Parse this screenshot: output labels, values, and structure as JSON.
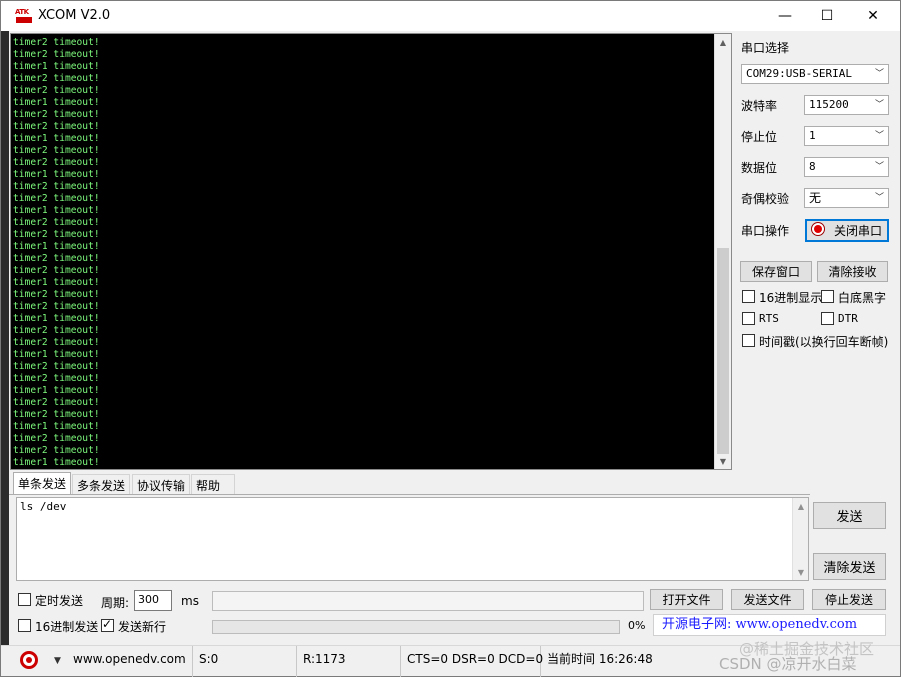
{
  "window": {
    "title": "XCOM V2.0",
    "icon_text": "ATK",
    "min_glyph": "—",
    "max_glyph": "☐",
    "close_glyph": "✕"
  },
  "receive": {
    "lines": [
      "timer2 timeout!",
      "timer2 timeout!",
      "timer1 timeout!",
      "timer2 timeout!",
      "timer2 timeout!",
      "timer1 timeout!",
      "timer2 timeout!",
      "timer2 timeout!",
      "timer1 timeout!",
      "timer2 timeout!",
      "timer2 timeout!",
      "timer1 timeout!",
      "timer2 timeout!",
      "timer2 timeout!",
      "timer1 timeout!",
      "timer2 timeout!",
      "timer2 timeout!",
      "timer1 timeout!",
      "timer2 timeout!",
      "timer2 timeout!",
      "timer1 timeout!",
      "timer2 timeout!",
      "timer2 timeout!",
      "timer1 timeout!",
      "timer2 timeout!",
      "timer2 timeout!",
      "timer1 timeout!",
      "timer2 timeout!",
      "timer2 timeout!",
      "timer1 timeout!",
      "timer2 timeout!",
      "timer2 timeout!",
      "timer1 timeout!",
      "timer2 timeout!",
      "timer2 timeout!",
      "timer1 timeout!",
      "timer2 timeout!"
    ]
  },
  "settings": {
    "port_label": "串口选择",
    "port_value": "COM29:USB-SERIAL",
    "baud_label": "波特率",
    "baud_value": "115200",
    "stop_label": "停止位",
    "stop_value": "1",
    "data_label": "数据位",
    "data_value": "8",
    "parity_label": "奇偶校验",
    "parity_value": "无",
    "op_label": "串口操作",
    "close_port_btn": "关闭串口",
    "save_window_btn": "保存窗口",
    "clear_recv_btn": "清除接收",
    "hex_display": "16进制显示",
    "white_bg": "白底黑字",
    "rts": "RTS",
    "dtr": "DTR",
    "timestamp": "时间戳(以换行回车断帧)"
  },
  "tabs": [
    "单条发送",
    "多条发送",
    "协议传输",
    "帮助"
  ],
  "send": {
    "text": "ls /dev",
    "send_btn": "发送",
    "clear_send_btn": "清除发送",
    "timed_send": "定时发送",
    "period_label": "周期:",
    "period_value": "300",
    "period_unit": "ms",
    "open_file_btn": "打开文件",
    "send_file_btn": "发送文件",
    "stop_send_btn": "停止发送",
    "hex_send": "16进制发送",
    "newline_send": "发送新行",
    "progress_pct": "0%",
    "progress_value": 0,
    "site_link": "开源电子网: www.openedv.com"
  },
  "status": {
    "url": "www.openedv.com",
    "sent": "S:0",
    "received": "R:1173",
    "lines": "CTS=0 DSR=0 DCD=0",
    "time": "当前时间 16:26:48"
  },
  "watermark": {
    "line1": "@稀土掘金技术社区",
    "line2": "CSDN @凉开水白菜"
  }
}
